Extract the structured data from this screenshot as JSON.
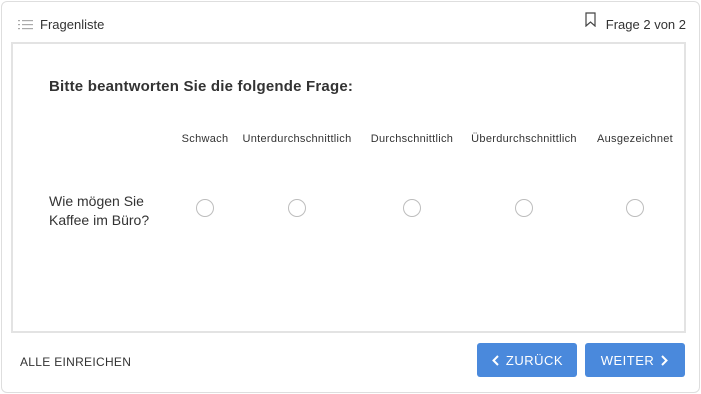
{
  "header": {
    "list_label": "Fragenliste",
    "progress": "Frage 2 von 2"
  },
  "question": {
    "title": "Bitte beantworten Sie die folgende Frage:",
    "scale": [
      "Schwach",
      "Unterdurchschnittlich",
      "Durchschnittlich",
      "Überdurchschnittlich",
      "Ausgezeichnet"
    ],
    "row_label": "Wie mögen Sie Kaffee im Büro?",
    "selected": null
  },
  "footer": {
    "submit_all": "ALLE EINREICHEN",
    "back": "ZURÜCK",
    "next": "WEITER"
  },
  "colors": {
    "accent": "#4a89dc",
    "border": "#e3e3e3",
    "radio_border": "#bdbdbd"
  },
  "icons": {
    "list": "list-icon",
    "bookmark": "bookmark-icon",
    "back": "chevron-left-icon",
    "next": "chevron-right-icon"
  }
}
